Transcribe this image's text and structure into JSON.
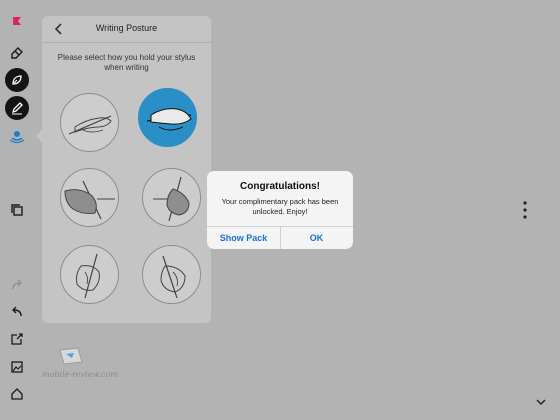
{
  "toolbar": {
    "items": [
      {
        "name": "bookmark-flag-icon",
        "color": "#e0206a"
      },
      {
        "name": "eraser-icon"
      },
      {
        "name": "leaf-brush-icon"
      },
      {
        "name": "pencil-icon"
      },
      {
        "name": "stylus-settings-icon",
        "color": "#1f7fc4"
      },
      {
        "name": "duplicate-icon"
      },
      {
        "name": "redo-icon"
      },
      {
        "name": "undo-icon"
      },
      {
        "name": "share-icon"
      },
      {
        "name": "image-icon"
      },
      {
        "name": "home-icon"
      }
    ]
  },
  "panel": {
    "title": "Writing Posture",
    "instructions": "Please select how you hold your stylus when writing",
    "selected_option": 2,
    "option_count": 6
  },
  "dialog": {
    "title": "Congratulations!",
    "message": "Your complimentary pack has been unlocked. Enjoy!",
    "buttons": {
      "show_pack": "Show Pack",
      "ok": "OK"
    },
    "accent_color": "#1672d9"
  },
  "watermark": {
    "text": "mobile-review.com"
  },
  "colors": {
    "background": "#b3b3b3",
    "panel": "#c4c4c4",
    "selected_posture": "#2a8fc6"
  }
}
